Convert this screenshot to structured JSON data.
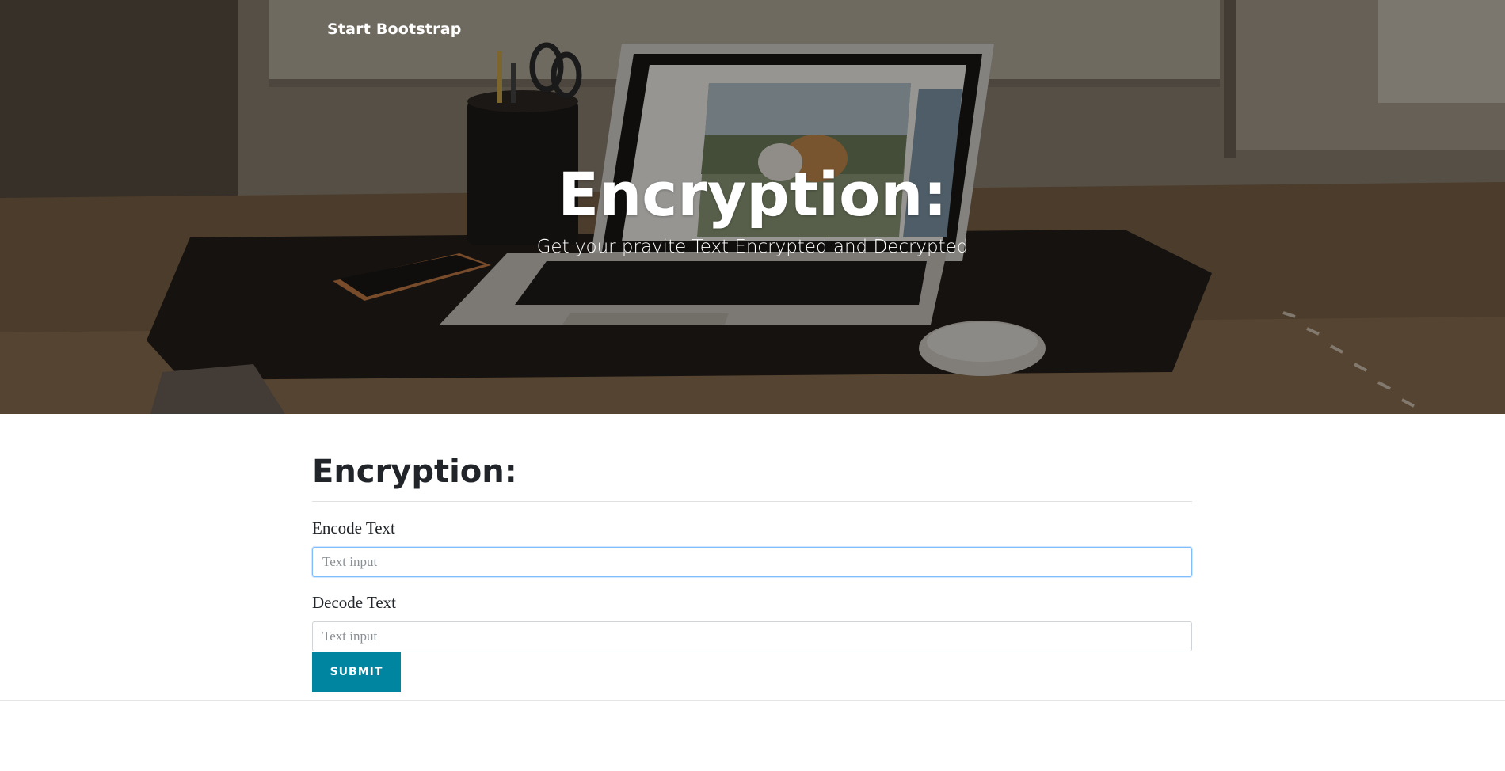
{
  "navbar": {
    "brand": "Start Bootstrap"
  },
  "hero": {
    "heading": "Encryption:",
    "subheading": "Get your pravite Text Encrypted and Decrypted",
    "background_image": "desk-laptop-photo"
  },
  "form": {
    "title": "Encryption:",
    "encode": {
      "label": "Encode Text",
      "placeholder": "Text input",
      "value": ""
    },
    "decode": {
      "label": "Decode Text",
      "placeholder": "Text input",
      "value": ""
    },
    "submit_label": "SUBMIT"
  },
  "colors": {
    "accent": "#0085a1",
    "focus_border": "#80bdff",
    "heading_text": "#212529"
  }
}
